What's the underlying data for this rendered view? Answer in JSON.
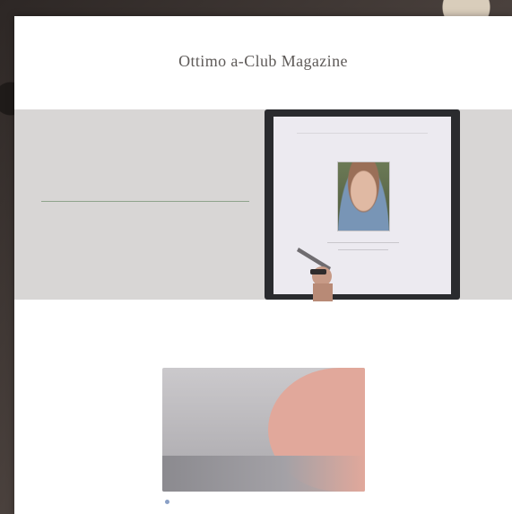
{
  "site": {
    "title": "Ottimo a-Club Magazine"
  },
  "nav": {
    "items": [
      "",
      "",
      "",
      "",
      "",
      "",
      "",
      ""
    ]
  },
  "hero": {
    "kicker": "",
    "subtitle": "",
    "screen_label": ""
  },
  "intro": {
    "text": ""
  },
  "promo": {
    "title": "",
    "cta": ""
  },
  "meta": {
    "text": ""
  },
  "colors": {
    "accent": "#d0a07e",
    "promo_pink": "#e1a89b",
    "hero_gray": "#d8d6d5"
  }
}
